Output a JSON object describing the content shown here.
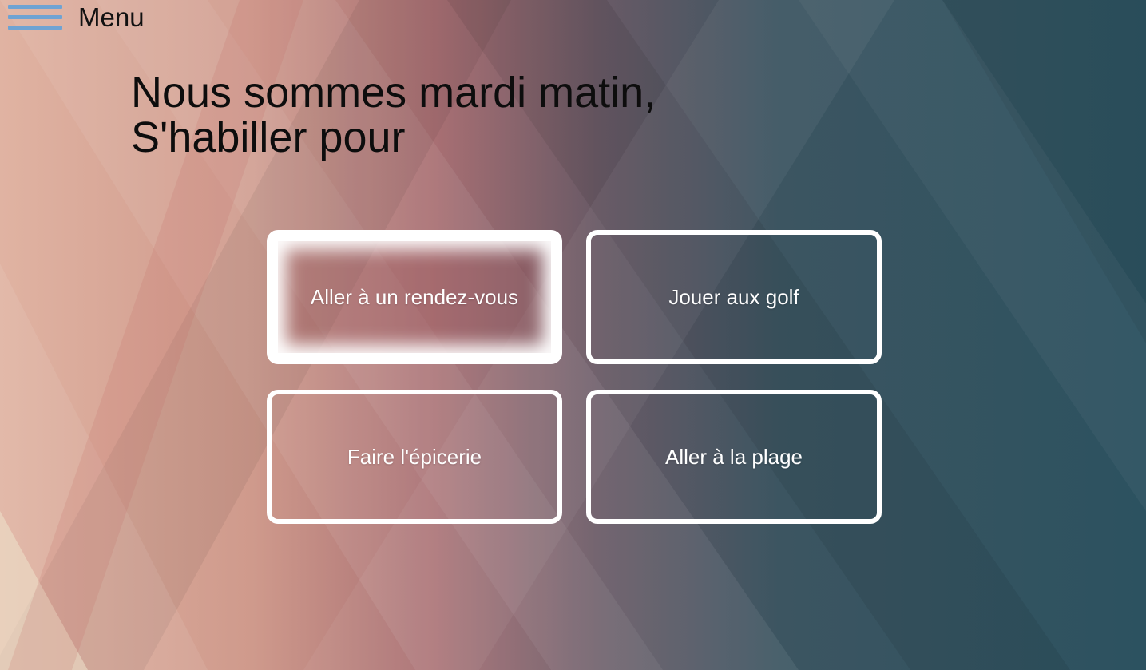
{
  "menu": {
    "icon": "hamburger-icon",
    "label": "Menu"
  },
  "heading": {
    "line1": "Nous sommes mardi matin,",
    "line2": "S'habiller pour"
  },
  "options": [
    {
      "label": "Aller à un rendez-vous",
      "selected": true
    },
    {
      "label": "Jouer aux golf",
      "selected": false
    },
    {
      "label": "Faire l'épicerie",
      "selected": false
    },
    {
      "label": "Aller à la plage",
      "selected": false
    }
  ],
  "colors": {
    "hamburger": "#6fa3d3",
    "option_border": "#ffffff",
    "background_dark": "#2f5661",
    "background_warm": "#d9a493"
  }
}
